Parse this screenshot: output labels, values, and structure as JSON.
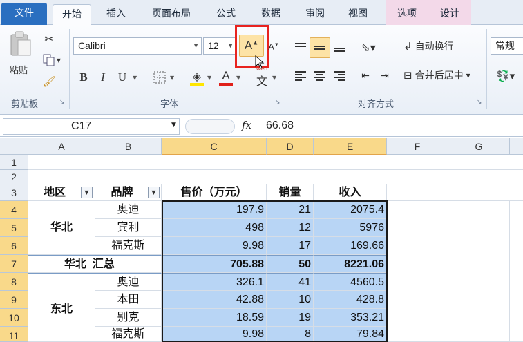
{
  "tabs": [
    {
      "label": "文件",
      "kind": "file"
    },
    {
      "label": "开始",
      "kind": "active"
    },
    {
      "label": "插入",
      "kind": "normal"
    },
    {
      "label": "页面布局",
      "kind": "normal"
    },
    {
      "label": "公式",
      "kind": "normal"
    },
    {
      "label": "数据",
      "kind": "normal"
    },
    {
      "label": "审阅",
      "kind": "normal"
    },
    {
      "label": "视图",
      "kind": "normal"
    },
    {
      "label": "选项",
      "kind": "contextual"
    },
    {
      "label": "设计",
      "kind": "contextual"
    }
  ],
  "ribbon": {
    "clipboard": {
      "paste_label": "粘贴",
      "group_label": "剪贴板"
    },
    "font": {
      "font_name": "Calibri",
      "font_size": "12",
      "group_label": "字体",
      "grow_font_highlighted": true
    },
    "alignment": {
      "wrap_text": "自动换行",
      "merge_center": "合并后居中",
      "group_label": "对齐方式"
    },
    "number": {
      "format": "常规"
    }
  },
  "formula_bar": {
    "name_box": "C17",
    "fx_label": "fx",
    "value": "66.68"
  },
  "columns": [
    "A",
    "B",
    "C",
    "D",
    "E",
    "F",
    "G"
  ],
  "selected_columns": [
    "C",
    "D",
    "E"
  ],
  "rows": [
    "1",
    "2",
    "3",
    "4",
    "5",
    "6",
    "7",
    "8",
    "9",
    "10",
    "11"
  ],
  "selected_rows": [
    "4",
    "5",
    "6",
    "7",
    "8",
    "9",
    "10",
    "11"
  ],
  "table": {
    "headers": {
      "region": "地区",
      "brand": "品牌",
      "price": "售价（万元）",
      "qty": "销量",
      "revenue": "收入"
    },
    "groups": [
      {
        "region": "华北",
        "rows": [
          {
            "brand": "奥迪",
            "price": "197.9",
            "qty": "21",
            "revenue": "2075.4"
          },
          {
            "brand": "宾利",
            "price": "498",
            "qty": "12",
            "revenue": "5976"
          },
          {
            "brand": "福克斯",
            "price": "9.98",
            "qty": "17",
            "revenue": "169.66"
          }
        ]
      },
      {
        "region": "东北",
        "rows": [
          {
            "brand": "奥迪",
            "price": "326.1",
            "qty": "41",
            "revenue": "4560.5"
          },
          {
            "brand": "本田",
            "price": "42.88",
            "qty": "10",
            "revenue": "428.8"
          },
          {
            "brand": "别克",
            "price": "18.59",
            "qty": "19",
            "revenue": "353.21"
          },
          {
            "brand": "福克斯",
            "price": "9.98",
            "qty": "8",
            "revenue": "79.84"
          }
        ]
      }
    ],
    "subtotal": {
      "region": "华北",
      "label": "汇总",
      "price": "705.88",
      "qty": "50",
      "revenue": "8221.06"
    }
  },
  "colors": {
    "selection_fill": "#b8d5f5",
    "header_highlight": "#f9d98a",
    "file_tab": "#2a6fc0",
    "callout": "#e8231f"
  }
}
